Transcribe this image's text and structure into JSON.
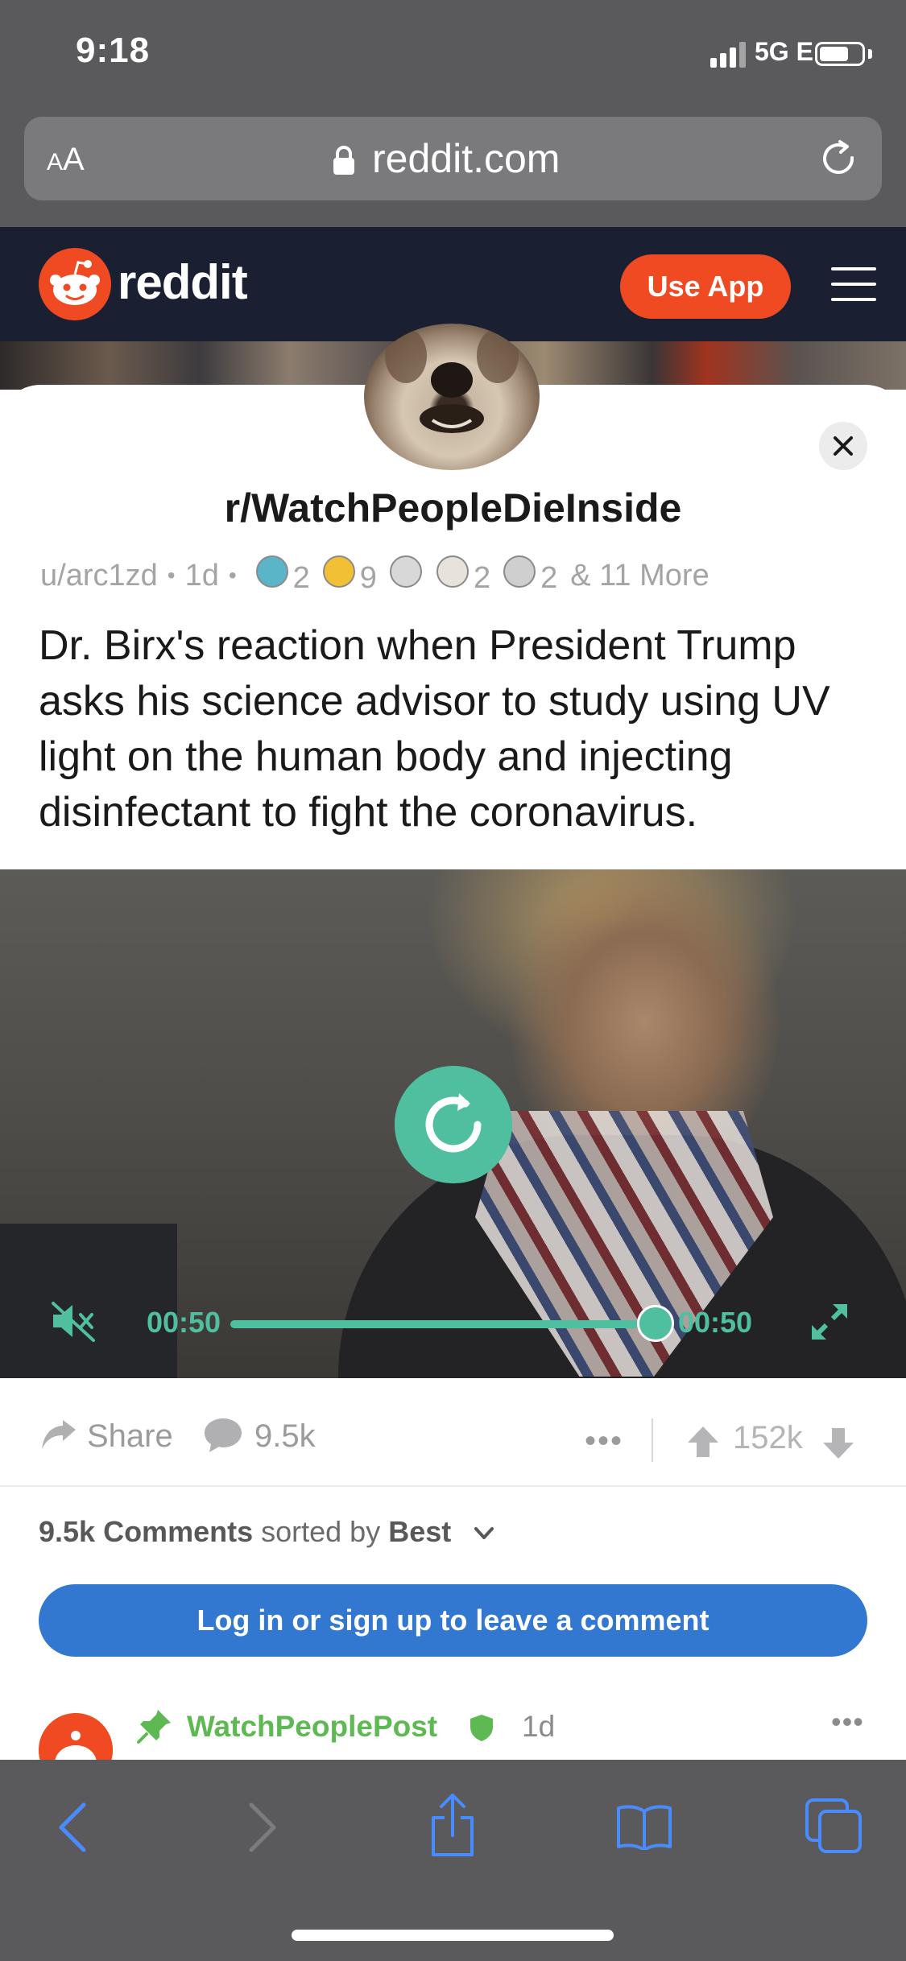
{
  "status_bar": {
    "time": "9:18",
    "network": "5G E",
    "battery_level": 0.7
  },
  "browser": {
    "text_size_label_small": "A",
    "text_size_label_large": "A",
    "url": "reddit.com"
  },
  "header": {
    "logo_text": "reddit",
    "use_app_label": "Use App"
  },
  "post": {
    "subreddit": "r/WatchPeopleDieInside",
    "author": "u/arc1zd",
    "age": "1d",
    "awards": [
      {
        "icon": "award-platinum-icon",
        "count": "2",
        "color": "#5bb5c9"
      },
      {
        "icon": "award-gold-icon",
        "count": "9",
        "color": "#f2c035"
      },
      {
        "icon": "award-skeleton-icon",
        "count": "",
        "color": "#d8d8d8"
      },
      {
        "icon": "award-goat-icon",
        "count": "2",
        "color": "#e8e3da"
      },
      {
        "icon": "award-skull-icon",
        "count": "2",
        "color": "#cfcfcf"
      }
    ],
    "more_awards": "& 11 More",
    "title": "Dr. Birx's reaction when President Trump asks his science advisor to study using UV light on the human body and injecting disinfectant to fight the coronavirus."
  },
  "video": {
    "elapsed": "00:50",
    "duration": "00:50",
    "progress": 1.0,
    "accent": "#4fbfa0"
  },
  "actions": {
    "share_label": "Share",
    "comment_count": "9.5k",
    "more": "•••",
    "vote_count": "152k"
  },
  "comments": {
    "count_label": "9.5k Comments",
    "sorted_by_label": "sorted by",
    "sort_value": "Best",
    "login_prompt": "Log in or sign up to leave a comment",
    "first": {
      "username": "WatchPeoplePost",
      "age": "1d",
      "more": "•••"
    }
  },
  "colors": {
    "reddit_orange": "#f04a23",
    "header_bg": "#1a2032",
    "link_blue": "#3277d0",
    "mod_green": "#5fb953",
    "safari_chrome": "#5a5a5c"
  }
}
